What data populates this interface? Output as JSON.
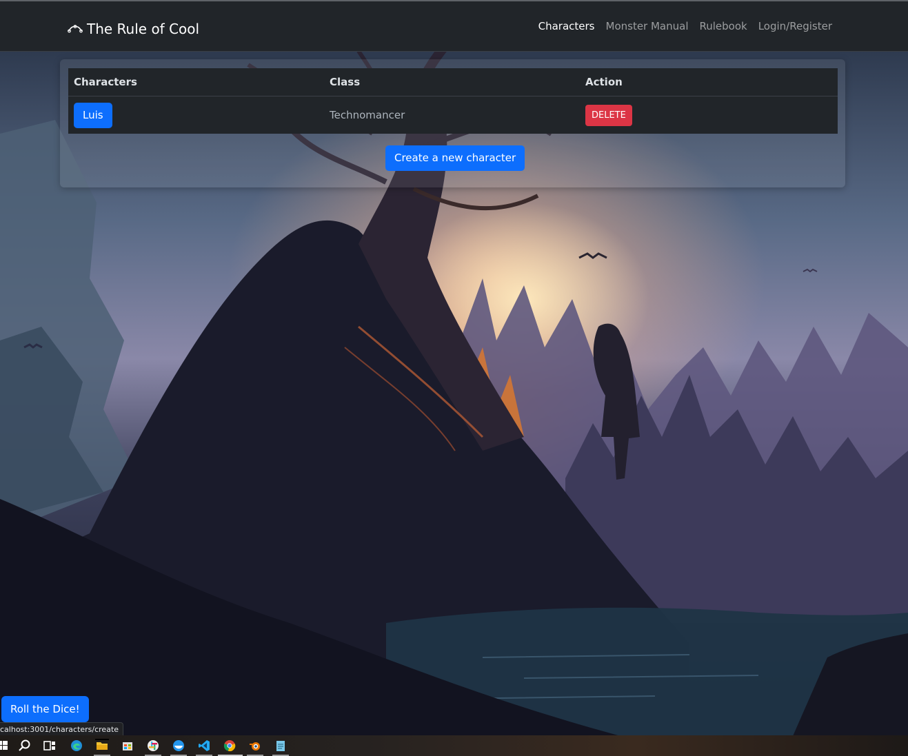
{
  "window": {
    "url_status": "calhost:3001/characters/create"
  },
  "navbar": {
    "brand": "The Rule of Cool",
    "links": [
      {
        "label": "Characters",
        "active": true
      },
      {
        "label": "Monster Manual",
        "active": false
      },
      {
        "label": "Rulebook",
        "active": false
      },
      {
        "label": "Login/Register",
        "active": false
      }
    ]
  },
  "table": {
    "headers": [
      "Characters",
      "Class",
      "Action"
    ],
    "rows": [
      {
        "name": "Luis",
        "class": "Technomancer",
        "action": "DELETE"
      }
    ]
  },
  "buttons": {
    "create": "Create a new character",
    "roll": "Roll the Dice!"
  },
  "colors": {
    "primary": "#0d6efd",
    "danger": "#dc3545",
    "navbar": "#212529"
  },
  "taskbar": {
    "icons": [
      "windows-start-icon",
      "search-icon",
      "task-view-icon",
      "edge-icon",
      "file-explorer-icon",
      "microsoft-store-icon",
      "slack-icon",
      "docker-icon",
      "vscode-icon",
      "chrome-icon",
      "blender-icon",
      "notepad-icon"
    ]
  }
}
